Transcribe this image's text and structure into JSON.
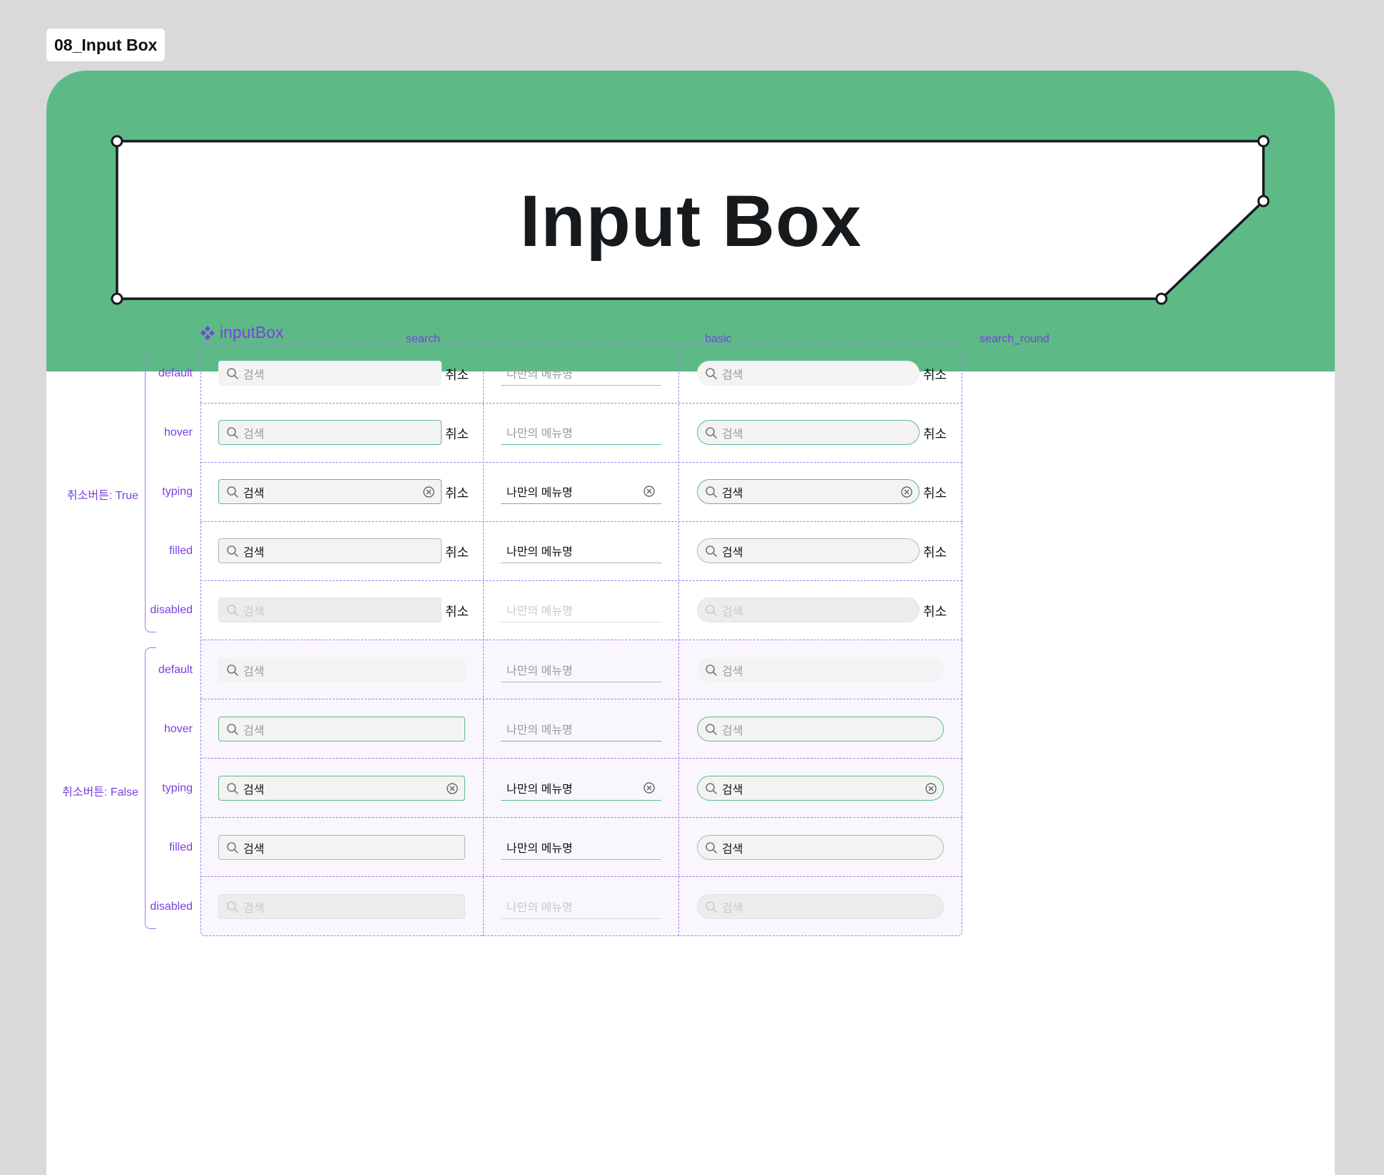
{
  "page_tag": "08_Input Box",
  "hero": {
    "title": "Input Box"
  },
  "component": {
    "name": "inputBox"
  },
  "columns": [
    "search",
    "basic",
    "search_round"
  ],
  "groups": [
    "취소버튼: True",
    "취소버튼: False"
  ],
  "states": [
    "default",
    "hover",
    "typing",
    "filled",
    "disabled"
  ],
  "fields": {
    "search_placeholder": "검색",
    "search_value": "검색",
    "basic_placeholder": "나만의 메뉴명",
    "basic_value": "나만의 메뉴명",
    "cancel_label": "취소"
  },
  "icons": {
    "search": "search-icon",
    "clear": "clear-circle-x-icon",
    "component": "component-diamond-icon"
  },
  "colors": {
    "accent_green": "#5dba87",
    "annotation_purple": "#7b3fe0",
    "hero_bg": "#5dba87"
  }
}
